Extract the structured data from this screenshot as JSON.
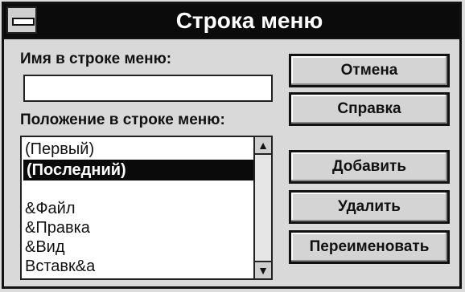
{
  "window": {
    "title": "Строка меню"
  },
  "labels": {
    "name": "Имя в строке меню:",
    "position": "Положение в строке меню:"
  },
  "name_input": {
    "value": ""
  },
  "position_list": {
    "items": [
      "(Первый)",
      "(Последний)",
      "",
      "&Файл",
      "&Правка",
      "&Вид",
      "Вставк&а"
    ],
    "selected_index": 1
  },
  "buttons": {
    "cancel": "Отмена",
    "help": "Справка",
    "add": "Добавить",
    "delete": "Удалить",
    "rename": "Переименовать"
  },
  "icons": {
    "system_menu": "system-menu-icon",
    "scroll_up": "arrow-up-icon",
    "scroll_down": "arrow-down-icon"
  }
}
